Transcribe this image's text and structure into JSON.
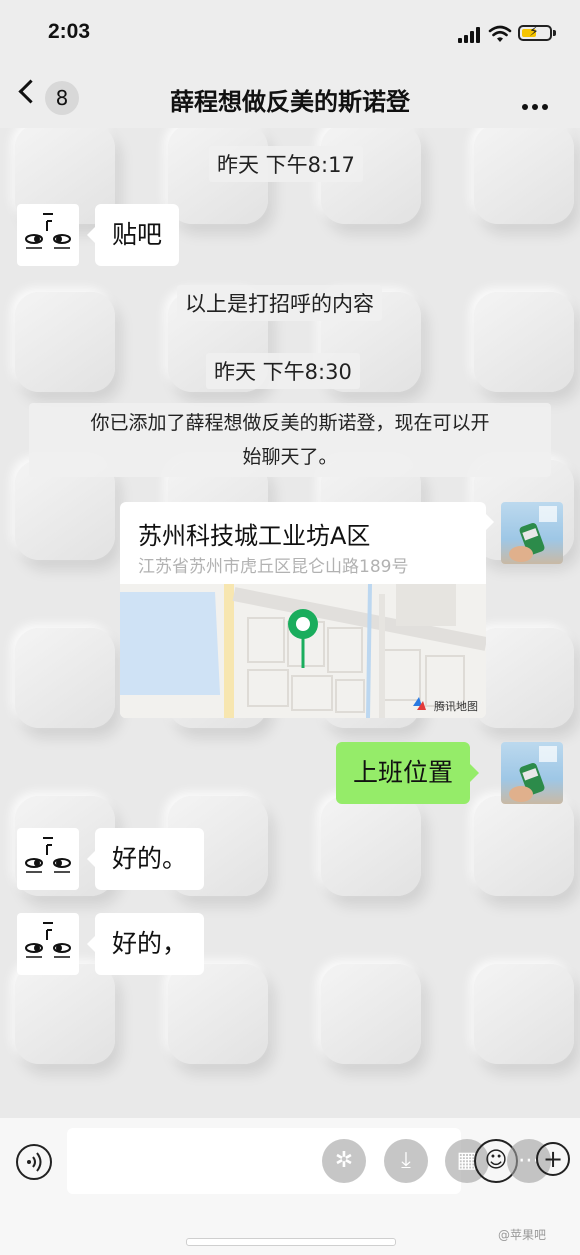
{
  "status_bar": {
    "time": "2:03"
  },
  "nav": {
    "back_badge": "8",
    "title": "薛程想做反美的斯诺登"
  },
  "messages": {
    "time1": "昨天 下午8:17",
    "msg1": "贴吧",
    "system_greeting": "以上是打招呼的内容",
    "time2": "昨天 下午8:30",
    "added_notice_line1": "你已添加了薛程想做反美的斯诺登，现在可以开",
    "added_notice_line2": "始聊天了。",
    "location": {
      "name": "苏州科技城工业坊A区",
      "address": "江苏省苏州市虎丘区昆仑山路189号",
      "map_credit": "腾讯地图"
    },
    "msg_self": "上班位置",
    "msg2": "好的。",
    "msg3": "好的，"
  },
  "input_bar": {
    "placeholder": ""
  },
  "watermark": "@苹果吧",
  "colors": {
    "self_bubble": "#95ec69",
    "map_pin": "#1aad5d",
    "background": "#e9e9e9"
  }
}
